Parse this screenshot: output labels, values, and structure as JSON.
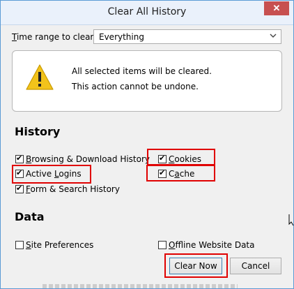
{
  "window": {
    "title": "Clear All History",
    "close_glyph": "✕",
    "accent": "#5b9bd5",
    "close_color": "#c75050"
  },
  "time_range": {
    "label_underlined": "T",
    "label_rest": "ime range to clear:",
    "selected": "Everything",
    "arrow_icon": "chevron-down-icon"
  },
  "warning": {
    "icon": "warning-icon",
    "line1": "All selected items will be cleared.",
    "line2": "This action cannot be undone."
  },
  "history": {
    "title": "History",
    "items": {
      "browsing": {
        "u": "B",
        "rest": "rowsing & Download History",
        "checked": true
      },
      "cookies": {
        "u": "C",
        "rest": "ookies",
        "checked": true
      },
      "logins": {
        "u": "",
        "rest": "Active ",
        "u2": "L",
        "rest2": "ogins",
        "checked": true
      },
      "cache": {
        "u": "",
        "rest": "C",
        "u2": "a",
        "rest2": "che",
        "checked": true
      },
      "forms": {
        "u": "F",
        "rest": "orm & Search History",
        "checked": true
      }
    }
  },
  "data": {
    "title": "Data",
    "items": {
      "site_prefs": {
        "u": "S",
        "rest": "ite Preferences",
        "checked": false
      },
      "offline": {
        "u": "O",
        "rest": "ffline Website Data",
        "checked": false
      }
    }
  },
  "buttons": {
    "clear_now": "Clear Now",
    "cancel": "Cancel"
  },
  "highlight_color": "#e00000"
}
